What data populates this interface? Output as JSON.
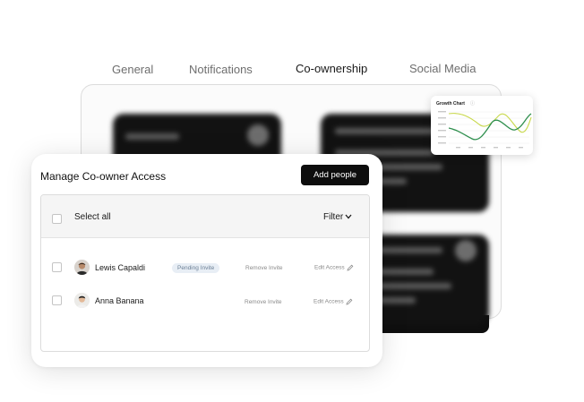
{
  "tabs": [
    {
      "label": "General",
      "active": false
    },
    {
      "label": "Notifications",
      "active": false
    },
    {
      "label": "Co-ownership",
      "active": true
    },
    {
      "label": "Social Media",
      "active": false
    }
  ],
  "growth_chart": {
    "title": "Growth Chart",
    "colors": {
      "series_a": "#c8d84a",
      "series_b": "#2f8f4e"
    }
  },
  "modal": {
    "title": "Manage Co-owner Access",
    "add_button_label": "Add people",
    "table": {
      "select_all_label": "Select all",
      "filter_label": "Filter",
      "rows": [
        {
          "name": "Lewis Capaldi",
          "badge": "Pending Invite",
          "remove_label": "Remove Invite",
          "edit_label": "Edit Access"
        },
        {
          "name": "Anna Banana",
          "badge": "",
          "remove_label": "Remove Invite",
          "edit_label": "Edit Access"
        }
      ]
    }
  },
  "colors": {
    "primary_button": "#0d0d0d",
    "badge_bg": "#e8eef5",
    "badge_text": "#6b7f95"
  }
}
